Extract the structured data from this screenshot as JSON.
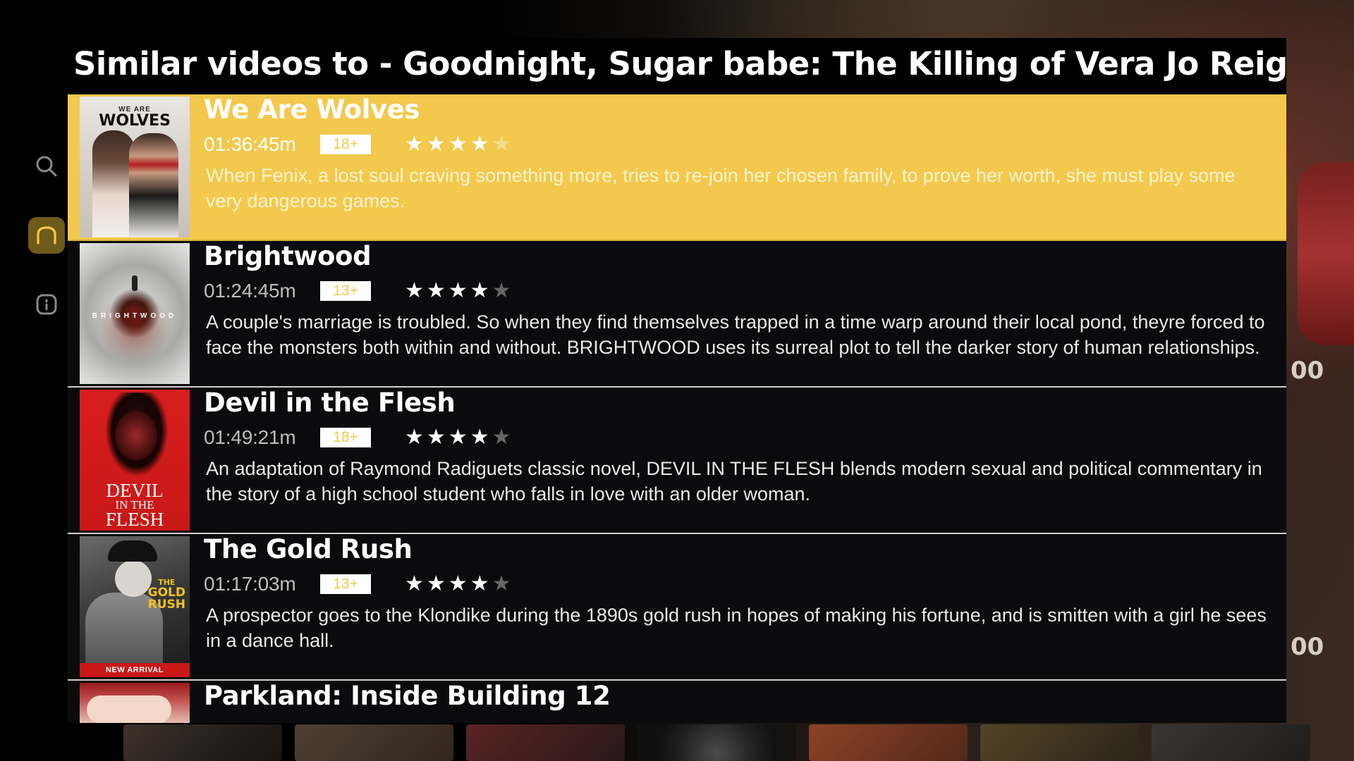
{
  "panel": {
    "title": "Similar videos to - Goodnight, Sugar babe: The Killing of Vera Jo Reigle"
  },
  "sidebar": {
    "items": [
      {
        "name": "search",
        "icon": "search-icon",
        "active": false
      },
      {
        "name": "home",
        "icon": "home-icon",
        "active": true
      },
      {
        "name": "info",
        "icon": "info-icon",
        "active": false
      }
    ]
  },
  "videos": [
    {
      "title": "We Are Wolves",
      "duration": "01:36:45m",
      "rating": "18+",
      "stars": 4,
      "description": "When Fenix, a lost soul craving something more, tries to re-join her chosen family, to prove her worth, she must play some very dangerous games.",
      "thumb": {
        "line1": "WE ARE",
        "line2": "WOLVES"
      },
      "selected": true
    },
    {
      "title": "Brightwood",
      "duration": "01:24:45m",
      "rating": "13+",
      "stars": 4,
      "description": "A couple's marriage is troubled. So when they find themselves trapped in a time warp around their local pond, theyre forced to face the monsters both within and without. BRIGHTWOOD uses its surreal plot to tell the darker story of human relationships.",
      "thumb": {
        "line1": "BRIGHTWOOD"
      },
      "selected": false
    },
    {
      "title": "Devil in the Flesh",
      "duration": "01:49:21m",
      "rating": "18+",
      "stars": 4,
      "description": "An adaptation of Raymond Radiguets classic novel, DEVIL IN THE FLESH blends modern sexual and political commentary in the story of a high school student who falls in love with an older woman.",
      "thumb": {
        "line1": "DEVIL",
        "line2": "IN THE",
        "line3": "FLESH"
      },
      "selected": false
    },
    {
      "title": "The Gold Rush",
      "duration": "01:17:03m",
      "rating": "13+",
      "stars": 4,
      "description": "A prospector goes to the Klondike during the 1890s gold rush in hopes of making his fortune, and is smitten with a girl he sees in a dance hall.",
      "thumb": {
        "line1": "THE",
        "line2": "GOLD",
        "line3": "RUSH",
        "badge": "NEW ARRIVAL"
      },
      "selected": false
    },
    {
      "title": "Parkland: Inside Building 12",
      "selected": false
    }
  ],
  "star_glyph": "★",
  "colors": {
    "selected_bg": "#f2c94c",
    "panel_bg": "#0b0b0d",
    "nav_active": "#6e5a1a"
  }
}
